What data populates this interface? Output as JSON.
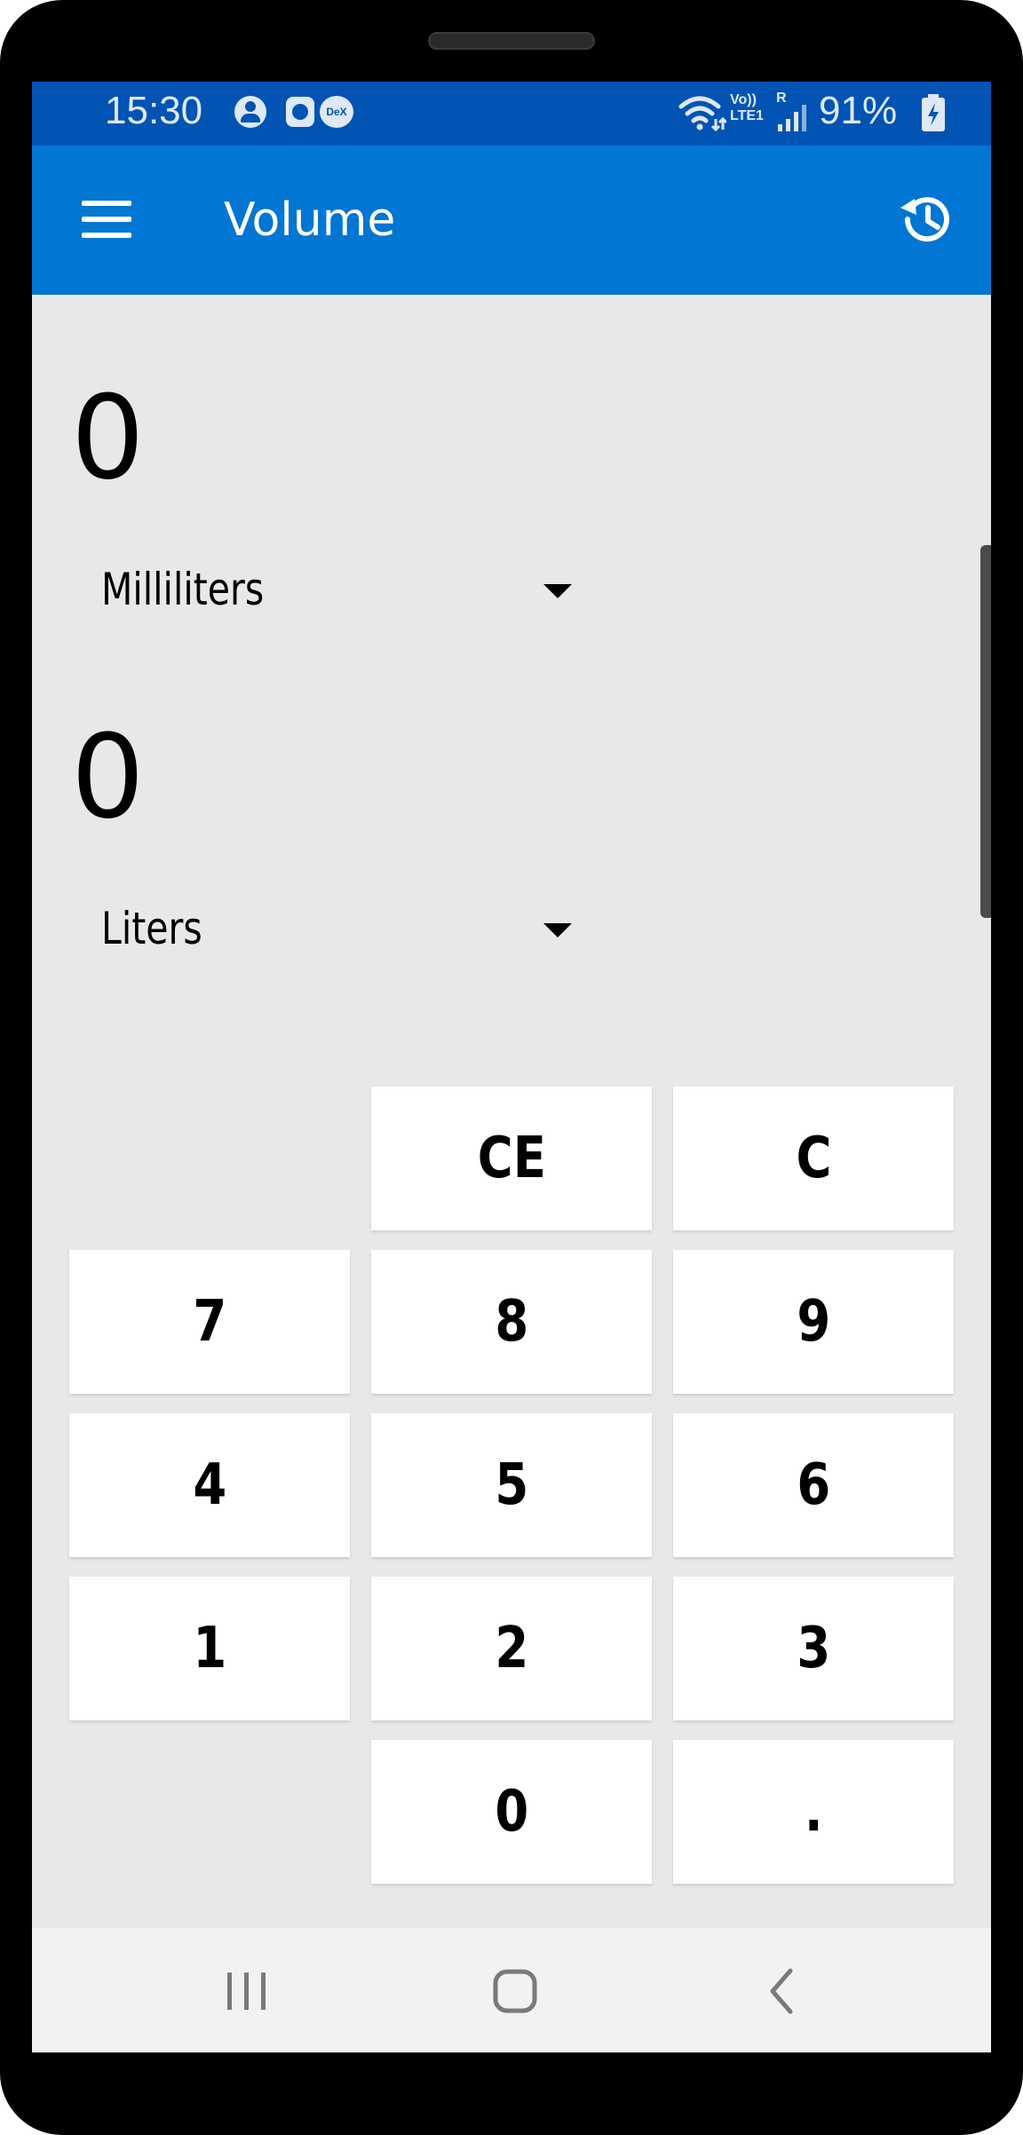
{
  "status_bar": {
    "time": "15:30",
    "icons": [
      "account-icon",
      "clock-icon",
      "dex-icon",
      "wifi-icon",
      "volte-icon",
      "signal-icon",
      "battery-icon"
    ],
    "dex_label": "DeX",
    "volte_label_top": "Vo))",
    "volte_label_bottom": "LTE1",
    "roaming_label": "R",
    "battery": "91%",
    "colors": {
      "background": "#0154b4",
      "foreground": "#dfe8f5"
    }
  },
  "app_bar": {
    "title": "Volume",
    "menu_icon": "hamburger-menu-icon",
    "history_icon": "history-icon",
    "color": "#0176d3"
  },
  "converter": {
    "input_value": "0",
    "input_unit": "Milliliters",
    "output_value": "0",
    "output_unit": "Liters"
  },
  "keypad": {
    "row1": [
      "CE",
      "C"
    ],
    "row2": [
      "7",
      "8",
      "9"
    ],
    "row3": [
      "4",
      "5",
      "6"
    ],
    "row4": [
      "1",
      "2",
      "3"
    ],
    "row5": [
      "0",
      "."
    ]
  },
  "nav_bar": {
    "icons": [
      "recents-icon",
      "home-icon",
      "back-icon"
    ]
  }
}
